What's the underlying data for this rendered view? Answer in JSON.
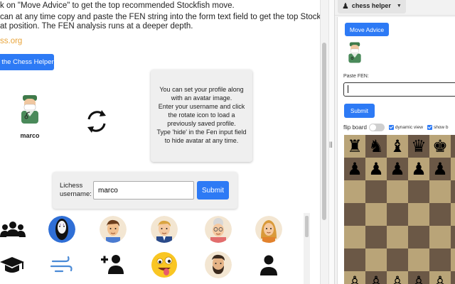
{
  "main": {
    "instructions": [
      "k on \"Move Advice\" to get the top recommended Stockfish move.",
      "can at any time copy and paste the FEN string into the form text field to get the top Stockfish move",
      "at position. The FEN analysis runs at a deeper depth."
    ],
    "site_link": "ss.org",
    "open_helper_button": "n the Chess Helper",
    "profile_name": "marco",
    "info_text": "You can set your profile along with an avatar image.\nEnter your username and click the rotate icon to load a previously saved profile.\nType 'hide' in the Fen input field to hide avatar at any time.",
    "lichess_label": "Lichess username:",
    "lichess_value": "marco",
    "lichess_submit": "Submit",
    "avatar_grid": [
      "group-icon",
      "no-face-avatar",
      "man-avatar",
      "businessman-avatar",
      "grandma-avatar",
      "woman-avatar",
      "graduation-cap-icon",
      "wind-icon",
      "add-user-icon",
      "silly-face-avatar",
      "bearded-man-avatar",
      "person-icon"
    ]
  },
  "panel": {
    "helper_title": "chess helper",
    "advice_button": "Move Advice",
    "fen_label": "Paste FEN:",
    "fen_value": "",
    "fen_submit": "Submit",
    "flip_board_label": "flip board",
    "dynamic_view_label": "dynamic view",
    "show_label": "show b",
    "board_rows": [
      [
        "♜",
        "♞",
        "♝",
        "♛",
        "♚",
        "♝",
        "♞"
      ],
      [
        "♟",
        "♟",
        "♟",
        "♟",
        "♟",
        "♟",
        "♟"
      ],
      [
        "",
        "",
        "",
        "",
        "",
        "",
        ""
      ],
      [
        "",
        "",
        "",
        "",
        "",
        "",
        ""
      ],
      [
        "",
        "",
        "",
        "",
        "",
        "",
        ""
      ],
      [
        "",
        "",
        "",
        "",
        "",
        "",
        ""
      ],
      [
        "♙",
        "♙",
        "♙",
        "♙",
        "♙",
        "♙",
        "♙"
      ]
    ]
  },
  "colors": {
    "accent": "#2d7af5",
    "link": "#e8a43a",
    "board_light": "#b9a478",
    "board_dark": "#6b5846"
  }
}
